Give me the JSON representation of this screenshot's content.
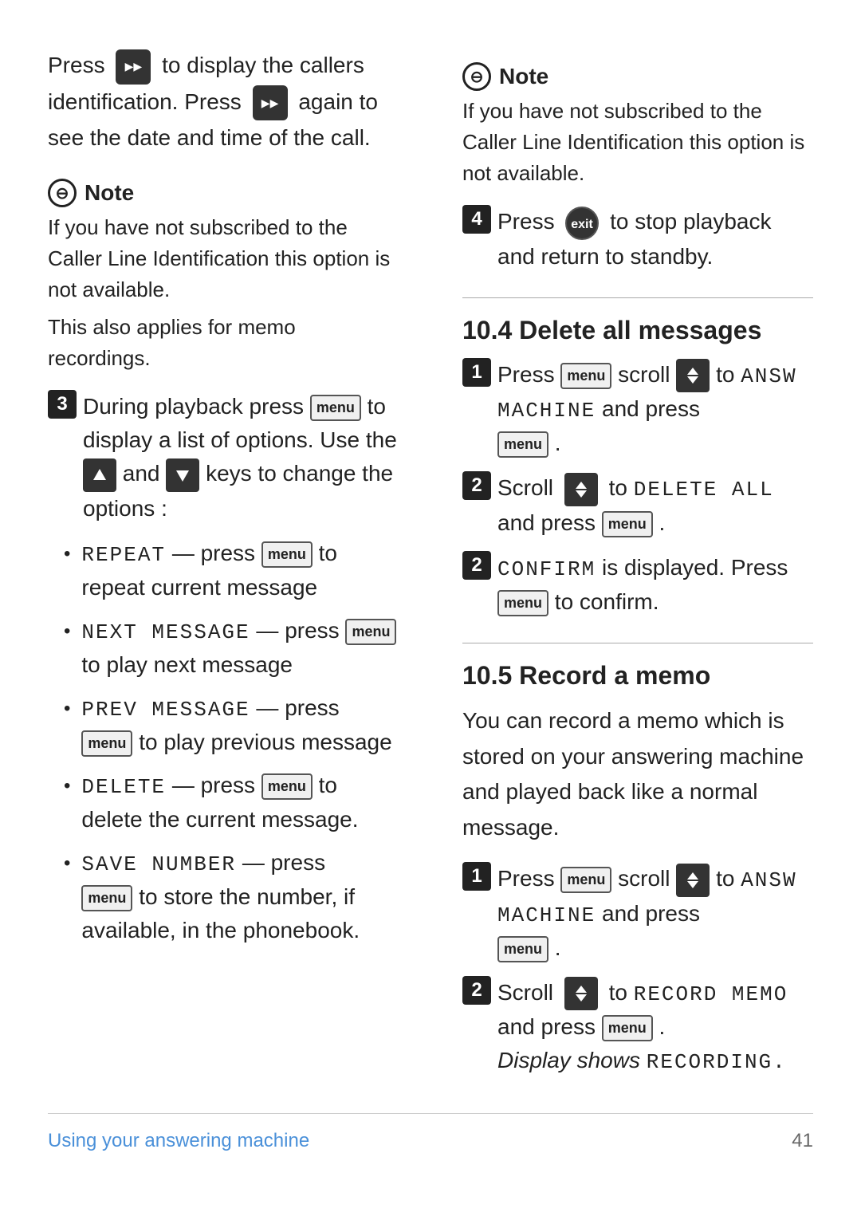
{
  "left": {
    "intro": {
      "text1": "Press",
      "text2": "to display the callers identification. Press",
      "text3": "again to see the date and time of the call."
    },
    "note1": {
      "header": "Note",
      "lines": [
        "If you have not subscribed to the Caller Line Identification this option is not available.",
        "This also applies for memo recordings."
      ]
    },
    "step3": {
      "num": "3",
      "text1": "During playback press",
      "text2": "to display a list of options. Use the",
      "text3": "and",
      "text4": "keys to change the options :"
    },
    "bullets": [
      {
        "code": "REPEAT",
        "action": "press",
        "desc": "to repeat current message"
      },
      {
        "code": "NEXT MESSAGE",
        "action": "press",
        "desc": "to play next message"
      },
      {
        "code": "PREV MESSAGE",
        "action": "press",
        "desc": "to play previous message"
      },
      {
        "code": "DELETE",
        "action": "press",
        "desc": "to delete the current message."
      },
      {
        "code": "SAVE NUMBER",
        "action": "press",
        "desc": "to store the number, if available, in the phonebook."
      }
    ]
  },
  "right": {
    "note2": {
      "header": "Note",
      "lines": [
        "If you have not subscribed to the Caller Line Identification this option is not available."
      ]
    },
    "step4": {
      "num": "4",
      "text1": "Press",
      "text2": "to stop playback and return to standby."
    },
    "section104": {
      "title": "10.4  Delete all messages",
      "step1": {
        "num": "1",
        "text1": "Press",
        "text2": "scroll",
        "text3": "to",
        "code": "ANSW MACHINE",
        "text4": "and press",
        "text5": "."
      },
      "step2a": {
        "num": "2",
        "text1": "Scroll",
        "text2": "to",
        "code": "DELETE ALL",
        "text3": "and press",
        "text4": "."
      },
      "step2b": {
        "num": "2",
        "code": "CONFIRM",
        "text1": "is displayed. Press",
        "text2": "to confirm."
      }
    },
    "section105": {
      "title": "10.5  Record a memo",
      "intro": "You can record a memo which is stored on your answering machine and played back like a normal message.",
      "step1": {
        "num": "1",
        "text1": "Press",
        "text2": "scroll",
        "text3": "to",
        "code": "ANSW MACHINE",
        "text4": "and press",
        "text5": "."
      },
      "step2": {
        "num": "2",
        "text1": "Scroll",
        "text2": "to",
        "code1": "RECORD MEMO",
        "text3": "and press",
        "text4": ".",
        "italic": "Display shows",
        "code2": "RECORDING."
      }
    }
  },
  "footer": {
    "left": "Using your answering machine",
    "right": "41"
  }
}
